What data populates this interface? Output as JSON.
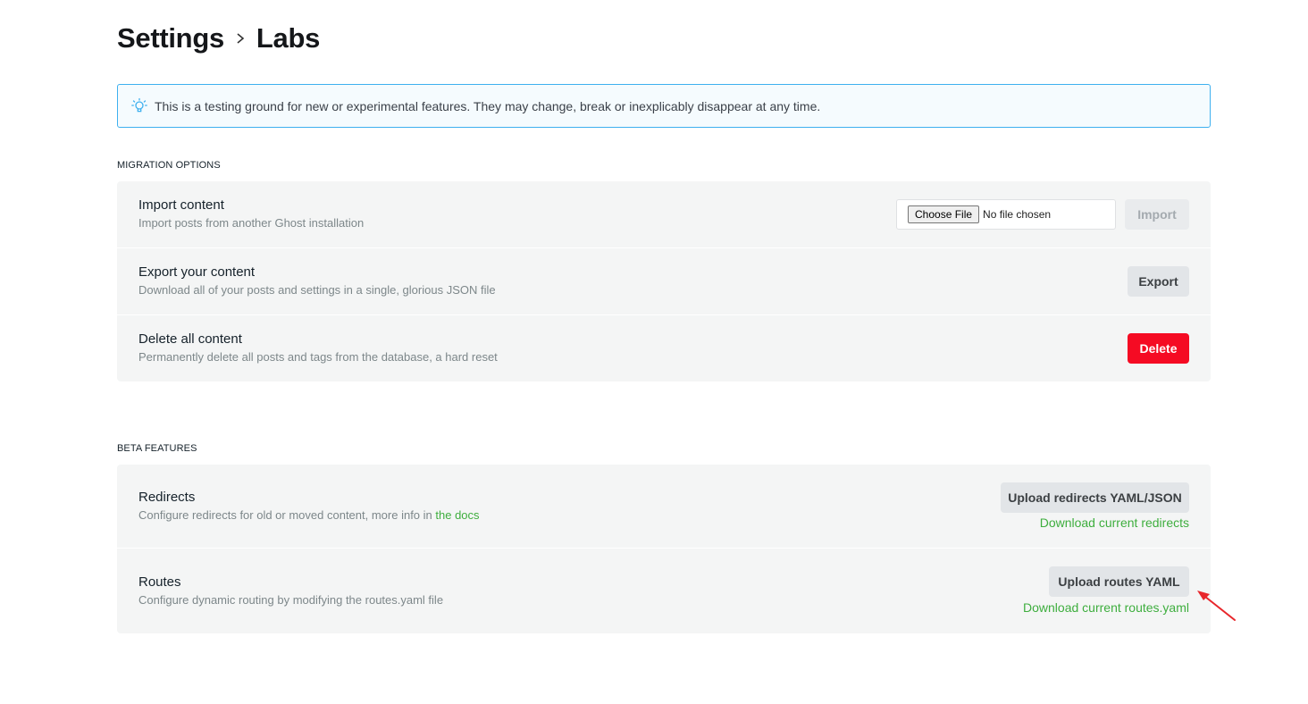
{
  "header": {
    "breadcrumb_root": "Settings",
    "breadcrumb_current": "Labs"
  },
  "notice": {
    "icon": "lightbulb-icon",
    "text": "This is a testing ground for new or experimental features. They may change, break or inexplicably disappear at any time."
  },
  "migration": {
    "title": "MIGRATION OPTIONS",
    "import": {
      "label": "Import content",
      "description": "Import posts from another Ghost installation",
      "choose_file": "Choose File",
      "no_file": "No file chosen",
      "button": "Import"
    },
    "export": {
      "label": "Export your content",
      "description": "Download all of your posts and settings in a single, glorious JSON file",
      "button": "Export"
    },
    "delete": {
      "label": "Delete all content",
      "description": "Permanently delete all posts and tags from the database, a hard reset",
      "button": "Delete"
    }
  },
  "beta": {
    "title": "BETA FEATURES",
    "redirects": {
      "label": "Redirects",
      "description_prefix": "Configure redirects for old or moved content, more info in ",
      "docs_link": "the docs",
      "upload_button": "Upload redirects YAML/JSON",
      "download_link": "Download current redirects"
    },
    "routes": {
      "label": "Routes",
      "description": "Configure dynamic routing by modifying the routes.yaml file",
      "upload_button": "Upload routes YAML",
      "download_link": "Download current routes.yaml"
    }
  },
  "colors": {
    "accent_blue": "#3eb0ef",
    "link_green": "#3eae3e",
    "delete_red": "#f50b23",
    "annotation_arrow": "#e8262b"
  }
}
